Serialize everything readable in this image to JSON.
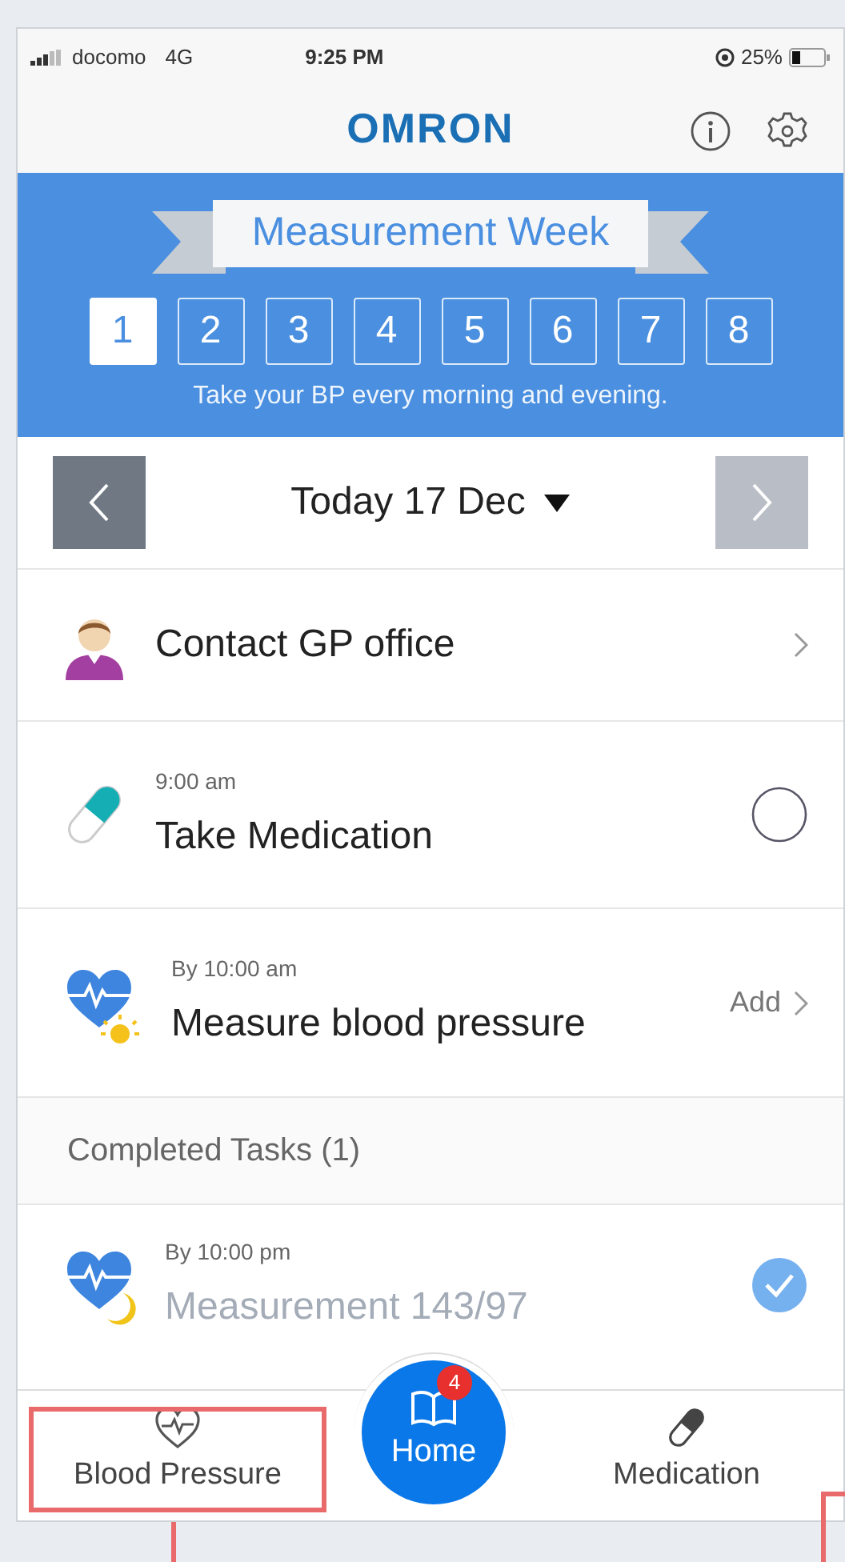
{
  "status_bar": {
    "carrier": "docomo",
    "network": "4G",
    "time": "9:25 PM",
    "battery": "25%"
  },
  "header": {
    "logo": "OMRON"
  },
  "banner": {
    "title": "Measurement Week",
    "subtitle": "Take your BP every morning and evening.",
    "days": [
      {
        "label": "1",
        "selected": true
      },
      {
        "label": "2",
        "selected": false
      },
      {
        "label": "3",
        "selected": false
      },
      {
        "label": "4",
        "selected": false
      },
      {
        "label": "5",
        "selected": false
      },
      {
        "label": "6",
        "selected": false
      },
      {
        "label": "7",
        "selected": false
      },
      {
        "label": "8",
        "selected": false
      }
    ]
  },
  "date_nav": {
    "label": "Today 17 Dec",
    "next_disabled": true
  },
  "tasks": [
    {
      "kind": "contact",
      "title": "Contact GP office"
    },
    {
      "kind": "medication",
      "time": "9:00 am",
      "title": "Take Medication",
      "checked": false
    },
    {
      "kind": "measure",
      "time": "By 10:00 am",
      "title": "Measure blood pressure",
      "action": "Add"
    }
  ],
  "completed": {
    "heading": "Completed Tasks (1)",
    "items": [
      {
        "kind": "measure_night",
        "time": "By 10:00 pm",
        "title": "Measurement 143/97",
        "checked": true
      }
    ]
  },
  "tab_bar": {
    "items": [
      {
        "kind": "bp",
        "label": "Blood Pressure",
        "highlighted": true
      },
      {
        "kind": "home",
        "label": "Home",
        "badge": "4"
      },
      {
        "kind": "medication",
        "label": "Medication",
        "highlighted": false
      }
    ]
  }
}
